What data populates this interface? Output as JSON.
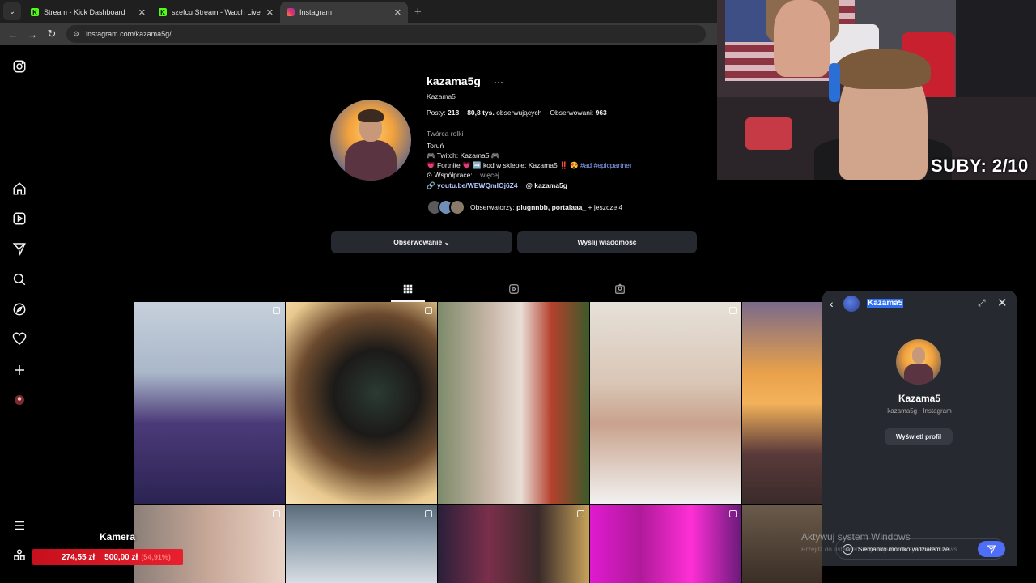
{
  "browser": {
    "tabs": [
      {
        "title": "Stream - Kick Dashboard",
        "icon": "kick-icon",
        "active": false
      },
      {
        "title": "szefcu Stream - Watch Live on Kick",
        "icon": "kick-icon",
        "active": false
      },
      {
        "title": "Instagram",
        "icon": "instagram-icon",
        "active": true
      }
    ],
    "url": "instagram.com/kazama5g/"
  },
  "profile": {
    "username": "kazama5g",
    "more": "···",
    "full_name": "Kazama5",
    "stats": {
      "posts_label": "Posty:",
      "posts_value": "218",
      "followers_value": "80,8 tys.",
      "followers_label": "obserwujących",
      "following_label": "Obserwowani:",
      "following_value": "963"
    },
    "category": "Twórca rolki",
    "bio_lines": [
      "Toruń",
      "🎮 Twitch: Kazama5 🎮",
      "💗 Fortnite 💗 ➡️ kod w sklepie: Kazama5 ‼️ 😍",
      "#ad #epicpartner",
      "⊙ Współprace:...",
      "więcej"
    ],
    "link": "youtube/WEWQmIOj6Z4",
    "link_display": "youtu.be/WEWQmIOj6Z4",
    "threads": "kazama5g",
    "followed_by_label": "Obserwatorzy:",
    "followed_by_names": "plugnnbb, portalaaa_",
    "followed_by_more": "+ jeszcze 4",
    "follow_button": "Obserwowanie",
    "message_button": "Wyślij wiadomość"
  },
  "chat": {
    "header_name": "Kazama5",
    "name": "Kazama5",
    "sub": "kazama5g · Instagram",
    "view_profile": "Wyświetl profil",
    "input_text": "Siemanko mordko widziałem że"
  },
  "overlay": {
    "subs": "SUBY: 2/10",
    "kamera": "Kamera",
    "goal_current": "274,55 zł",
    "goal_target": "500,00 zł",
    "goal_pct": "(54,91%)",
    "windows_activate": "Aktywuj system Windows",
    "windows_activate_sub": "Przejdź do ustawień, aby aktywować system Windows."
  },
  "colors": {
    "accent_link": "#b6c8ff",
    "hashtag": "#8faaff",
    "send_button": "#4f6ef7",
    "goal_bar": "#e7202e"
  }
}
